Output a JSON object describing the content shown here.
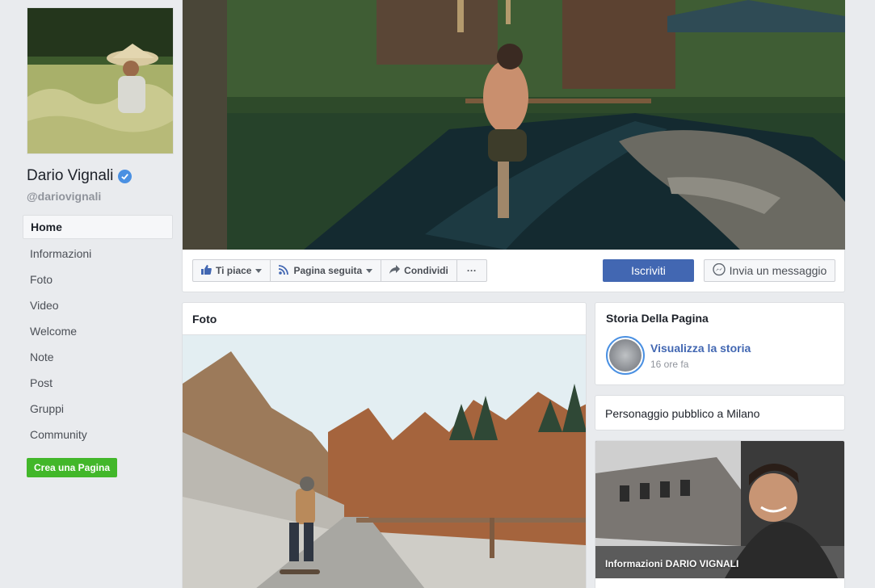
{
  "profile": {
    "name": "Dario Vignali",
    "username": "@dariovignali",
    "verified": true
  },
  "nav": {
    "items": [
      {
        "label": "Home",
        "active": true
      },
      {
        "label": "Informazioni"
      },
      {
        "label": "Foto"
      },
      {
        "label": "Video"
      },
      {
        "label": "Welcome"
      },
      {
        "label": "Note"
      },
      {
        "label": "Post"
      },
      {
        "label": "Gruppi"
      },
      {
        "label": "Community"
      }
    ],
    "create_page_label": "Crea una Pagina"
  },
  "actions": {
    "like_label": "Ti piace",
    "follow_label": "Pagina seguita",
    "share_label": "Condividi",
    "more_label": "···",
    "subscribe_label": "Iscriviti",
    "message_label": "Invia un messaggio"
  },
  "photos": {
    "title": "Foto"
  },
  "story": {
    "title": "Storia Della Pagina",
    "link_label": "Visualizza la storia",
    "time": "16 ore fa"
  },
  "category": {
    "text": "Personaggio pubblico a Milano"
  },
  "info": {
    "caption": "Informazioni DARIO VIGNALI"
  },
  "colors": {
    "background": "#e9ebee",
    "primary_blue": "#4267b2",
    "green": "#42b72a",
    "verified_blue": "#4a90e2"
  }
}
